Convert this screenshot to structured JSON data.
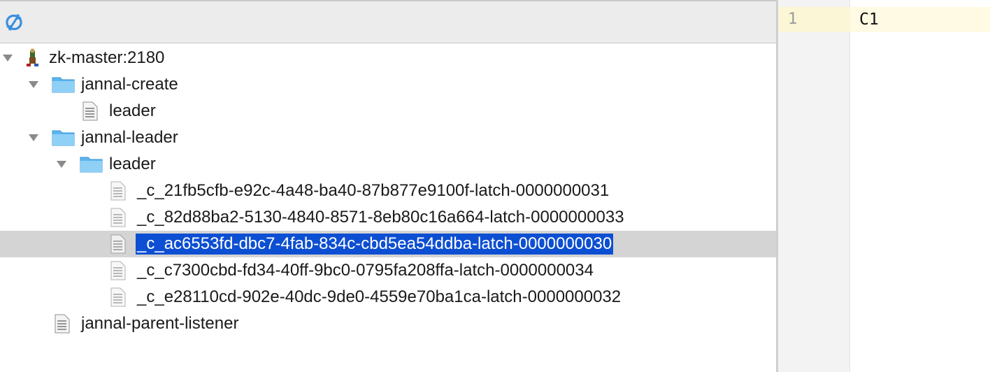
{
  "tree": {
    "root": {
      "label": "zk-master:2180",
      "expanded": true
    },
    "nodes": [
      {
        "label": "jannal-create",
        "type": "folder",
        "expanded": true
      },
      {
        "label": "leader",
        "type": "file"
      },
      {
        "label": "jannal-leader",
        "type": "folder",
        "expanded": true
      },
      {
        "label": "leader",
        "type": "folder",
        "expanded": true
      },
      {
        "label": "_c_21fb5cfb-e92c-4a48-ba40-87b877e9100f-latch-0000000031",
        "type": "file"
      },
      {
        "label": "_c_82d88ba2-5130-4840-8571-8eb80c16a664-latch-0000000033",
        "type": "file"
      },
      {
        "label": "_c_ac6553fd-dbc7-4fab-834c-cbd5ea54ddba-latch-0000000030",
        "type": "file",
        "selected": true
      },
      {
        "label": "_c_c7300cbd-fd34-40ff-9bc0-0795fa208ffa-latch-0000000034",
        "type": "file"
      },
      {
        "label": "_c_e28110cd-902e-40dc-9de0-4559e70ba1ca-latch-0000000032",
        "type": "file"
      },
      {
        "label": "jannal-parent-listener",
        "type": "file"
      }
    ]
  },
  "toolbar": {
    "refresh_icon": "refresh-icon"
  },
  "editor": {
    "line_number": "1",
    "content": "C1"
  },
  "colors": {
    "selection": "#0d4fd2",
    "selected_row": "#d4d4d4",
    "folder": "#5cb5ef",
    "current_line": "#fffae3"
  }
}
